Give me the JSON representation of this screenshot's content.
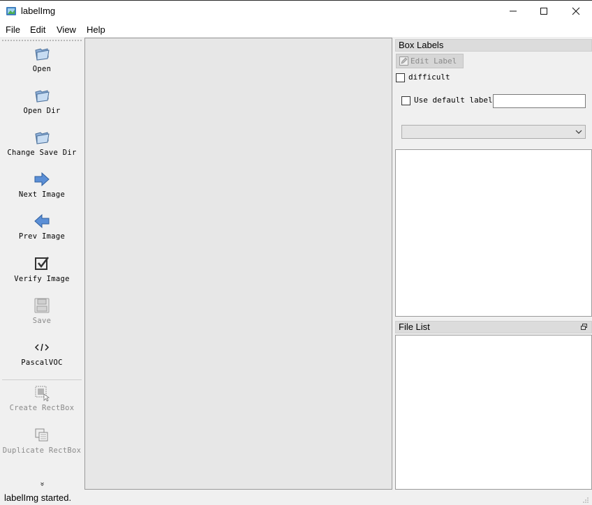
{
  "window": {
    "title": "labelImg",
    "controls": {
      "minimize": "minimize",
      "maximize": "maximize",
      "close": "close"
    }
  },
  "menu": {
    "items": [
      "File",
      "Edit",
      "View",
      "Help"
    ]
  },
  "toolbar": {
    "items": [
      {
        "label": "Open",
        "icon": "open-folder-icon",
        "enabled": true
      },
      {
        "label": "Open Dir",
        "icon": "open-folder-icon",
        "enabled": true
      },
      {
        "label": "Change Save Dir",
        "icon": "open-folder-icon",
        "enabled": true
      },
      {
        "label": "Next Image",
        "icon": "arrow-right-icon",
        "enabled": true
      },
      {
        "label": "Prev Image",
        "icon": "arrow-left-icon",
        "enabled": true
      },
      {
        "label": "Verify Image",
        "icon": "checkbox-icon",
        "enabled": true
      },
      {
        "label": "Save",
        "icon": "save-icon",
        "enabled": false
      },
      {
        "label": "PascalVOC",
        "icon": "code-icon",
        "enabled": true
      },
      {
        "label": "Create RectBox",
        "icon": "create-rectbox-icon",
        "enabled": false
      },
      {
        "label": "Duplicate RectBox",
        "icon": "duplicate-icon",
        "enabled": false
      }
    ],
    "more_glyph": "»"
  },
  "box_labels": {
    "title": "Box Labels",
    "edit_label_button": "Edit Label",
    "difficult": "difficult",
    "use_default_label": "Use default label",
    "default_label_value": ""
  },
  "file_list": {
    "title": "File List"
  },
  "status": {
    "text": "labelImg started."
  },
  "colors": {
    "accent_blue": "#4a7fc8",
    "canvas_bg": "#e7e7e7",
    "panel_bg": "#f0f0f0"
  }
}
